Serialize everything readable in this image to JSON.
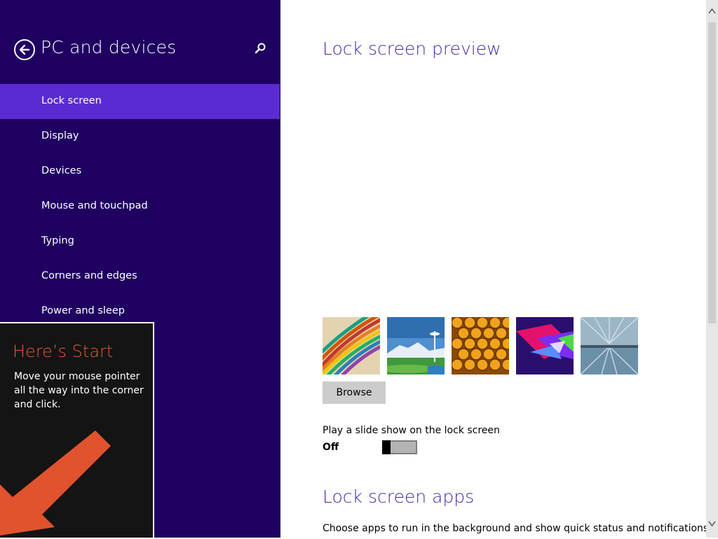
{
  "header": {
    "title": "PC and devices",
    "back_icon": "back-arrow-icon",
    "search_icon": "search-icon"
  },
  "colors": {
    "pane_bg": "#1f0061",
    "selected_bg": "#5b2bd2",
    "heading": "#4a2a9c",
    "tip_title": "#e8583a",
    "arrow": "#e0532e"
  },
  "sidebar": {
    "items": [
      {
        "label": "Lock screen",
        "selected": true
      },
      {
        "label": "Display"
      },
      {
        "label": "Devices"
      },
      {
        "label": "Mouse and touchpad"
      },
      {
        "label": "Typing"
      },
      {
        "label": "Corners and edges"
      },
      {
        "label": "Power and sleep"
      }
    ]
  },
  "tip": {
    "title": "Here’s Start",
    "text": "Move your mouse pointer all the way into the corner and click."
  },
  "main": {
    "preview_heading": "Lock screen preview",
    "browse_label": "Browse",
    "slideshow_label": "Play a slide show on the lock screen",
    "slideshow_state": "Off",
    "slideshow_on": false,
    "apps_heading": "Lock screen apps",
    "apps_description": "Choose apps to run in the background and show quick status and notifications,"
  }
}
